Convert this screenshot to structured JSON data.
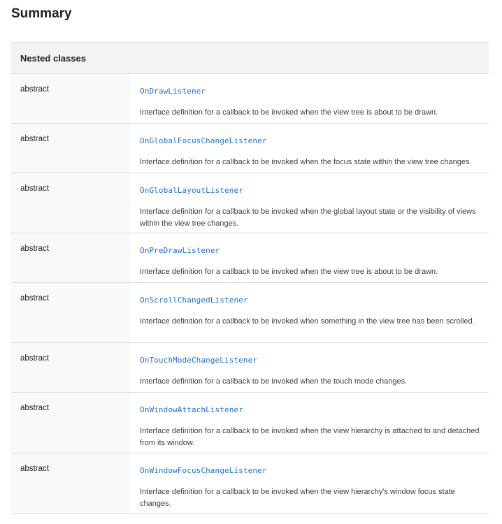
{
  "summary": {
    "title": "Summary"
  },
  "nested_classes": {
    "header": "Nested classes",
    "rows": [
      {
        "modifier": "abstract",
        "name": "OnDrawListener",
        "description": "Interface definition for a callback to be invoked when the view tree is about to be drawn."
      },
      {
        "modifier": "abstract",
        "name": "OnGlobalFocusChangeListener",
        "description": "Interface definition for a callback to be invoked when the focus state within the view tree changes."
      },
      {
        "modifier": "abstract",
        "name": "OnGlobalLayoutListener",
        "description": "Interface definition for a callback to be invoked when the global layout state or the visibility of views within the view tree changes."
      },
      {
        "modifier": "abstract",
        "name": "OnPreDrawListener",
        "description": "Interface definition for a callback to be invoked when the view tree is about to be drawn."
      },
      {
        "modifier": "abstract",
        "name": "OnScrollChangedListener",
        "description": "Interface definition for a callback to be invoked when something in the view tree has been scrolled."
      },
      {
        "modifier": "abstract",
        "name": "OnTouchModeChangeListener",
        "description": "Interface definition for a callback to be invoked when the touch mode changes."
      },
      {
        "modifier": "abstract",
        "name": "OnWindowAttachListener",
        "description": "Interface definition for a callback to be invoked when the view hierarchy is attached to and detached from its window."
      },
      {
        "modifier": "abstract",
        "name": "OnWindowFocusChangeListener",
        "description": "Interface definition for a callback to be invoked when the view hierarchy's window focus state changes."
      }
    ]
  },
  "colors": {
    "link": "#1a73e8",
    "header_bg": "#f1f3f4",
    "left_col_bg": "#f8f9fa",
    "divider": "#dadce0"
  }
}
